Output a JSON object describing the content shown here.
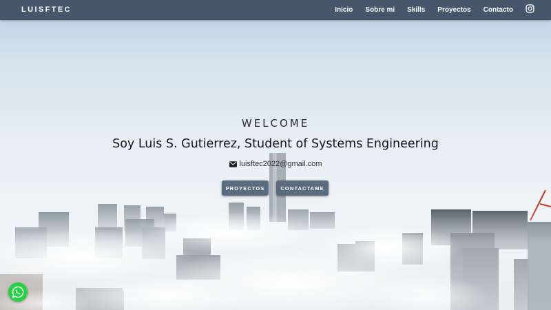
{
  "brand": "LUISFTEC",
  "nav": {
    "links": [
      "Inicio",
      "Sobre mi",
      "Skills",
      "Proyectos",
      "Contacto"
    ],
    "instagram_icon": "instagram-icon"
  },
  "hero": {
    "welcome": "WELCOME",
    "headline": "Soy Luis S. Gutierrez, Student of Systems Engineering",
    "email": "luisftec2022@gmail.com",
    "buttons": {
      "projects": "PROYECTOS",
      "contact": "CONTACTAME"
    }
  },
  "floating": {
    "whatsapp_icon": "whatsapp-icon"
  },
  "colors": {
    "navbar": "#46566b",
    "button": "#5b6b80",
    "whatsapp": "#27d045"
  }
}
